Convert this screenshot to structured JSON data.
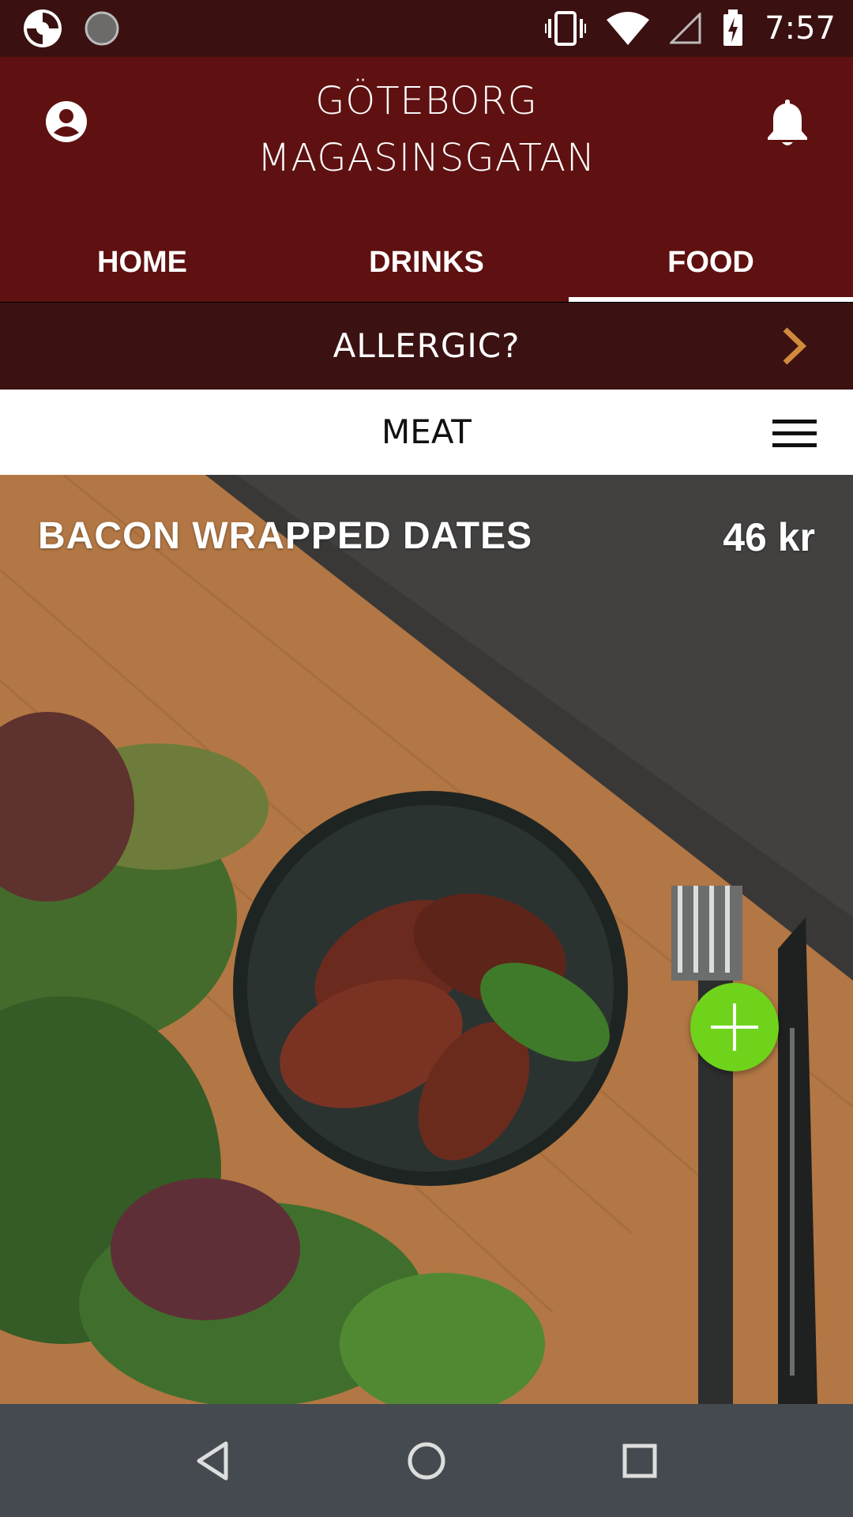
{
  "status_bar": {
    "time": "7:57",
    "icons": [
      "app-logo-icon",
      "loading-icon",
      "vibrate-icon",
      "wifi-icon",
      "signal-icon",
      "battery-charging-icon"
    ]
  },
  "header": {
    "title_line1": "GÖTEBORG",
    "title_line2": "MAGASINSGATAN",
    "icons": [
      "profile-icon",
      "bell-icon"
    ]
  },
  "tabs": [
    {
      "label": "HOME",
      "active": false
    },
    {
      "label": "DRINKS",
      "active": false
    },
    {
      "label": "FOOD",
      "active": true
    }
  ],
  "allergic": {
    "label": "ALLERGIC?",
    "icon": "chevron-right-icon",
    "icon_color": "#d18a3c"
  },
  "category": {
    "label": "MEAT",
    "icon": "hamburger-menu-icon"
  },
  "dish": {
    "name": "BACON WRAPPED DATES",
    "price": "46 kr",
    "add_icon": "plus-icon",
    "add_color": "#6fd31b"
  },
  "colors": {
    "statusbar": "#3a1010",
    "header": "#5e1110",
    "allergic_bar": "#3b1111",
    "navbar": "#444a4f"
  },
  "navigation": {
    "icons": [
      "back-icon",
      "home-icon",
      "recents-icon"
    ]
  }
}
